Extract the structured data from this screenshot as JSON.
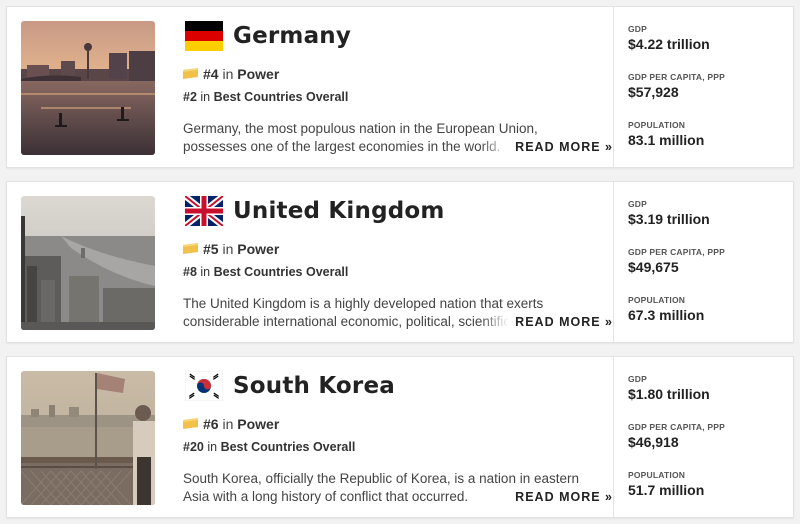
{
  "countries": [
    {
      "name": "Germany",
      "power_rank": "#4",
      "in_word": "in",
      "power_category": "Power",
      "overall_rank": "#2",
      "overall_category": "Best Countries Overall",
      "description": "Germany, the most populous nation in the European Union, possesses one of the largest economies in the world.",
      "read_more": "READ MORE »",
      "gdp_label": "GDP",
      "gdp": "$4.22 trillion",
      "gdp_pc_label": "GDP PER CAPITA, PPP",
      "gdp_pc": "$57,928",
      "population_label": "POPULATION",
      "population": "83.1 million",
      "flag_icon": "germany-flag-icon",
      "image": "berlin-river-sunset-photo"
    },
    {
      "name": "United Kingdom",
      "power_rank": "#5",
      "in_word": "in",
      "power_category": "Power",
      "overall_rank": "#8",
      "overall_category": "Best Countries Overall",
      "description": "The United Kingdom is a highly developed nation that exerts considerable international economic, political, scientific and cultural influence.",
      "read_more": "READ MORE »",
      "gdp_label": "GDP",
      "gdp": "$3.19 trillion",
      "gdp_pc_label": "GDP PER CAPITA, PPP",
      "gdp_pc": "$49,675",
      "population_label": "POPULATION",
      "population": "67.3 million",
      "flag_icon": "uk-flag-icon",
      "image": "london-aerial-photo"
    },
    {
      "name": "South Korea",
      "power_rank": "#6",
      "in_word": "in",
      "power_category": "Power",
      "overall_rank": "#20",
      "overall_category": "Best Countries Overall",
      "description": "South Korea, officially the Republic of Korea, is a nation in eastern Asia with a long history of conflict that occurred.",
      "read_more": "READ MORE »",
      "gdp_label": "GDP",
      "gdp": "$1.80 trillion",
      "gdp_pc_label": "GDP PER CAPITA, PPP",
      "gdp_pc": "$46,918",
      "population_label": "POPULATION",
      "population": "51.7 million",
      "flag_icon": "south-korea-flag-icon",
      "image": "seoul-river-ferry-photo"
    }
  ],
  "colors": {
    "badge": "#f2c14a",
    "text": "#222222",
    "muted": "#444444",
    "divider": "#e4e4e4"
  }
}
